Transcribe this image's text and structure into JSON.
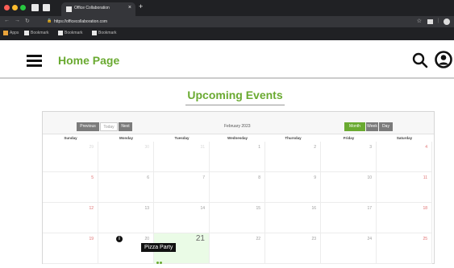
{
  "browser": {
    "tab_title": "Office Collaboration",
    "tab_close": "×",
    "new_tab": "+",
    "url": "https://officecollaboration.com",
    "bookmarks": [
      "Apps",
      "Bookmark",
      "Bookmark",
      "Bookmark"
    ],
    "colors": {
      "close": "#ff5f57",
      "minimize": "#febc2e",
      "maximize": "#28c840"
    }
  },
  "header": {
    "title": "Home Page"
  },
  "section": {
    "title": "Upcoming Events"
  },
  "calendar": {
    "nav": {
      "previous": "Previous",
      "today": "Today",
      "next": "Next"
    },
    "month_label": "February 2023",
    "views": {
      "month": "Month",
      "week": "Week",
      "day": "Day"
    },
    "weekdays": [
      "Sunday",
      "Monday",
      "Tuesday",
      "Wednesday",
      "Thursday",
      "Friday",
      "Saturday"
    ],
    "weeks": [
      [
        "29",
        "30",
        "31",
        "1",
        "2",
        "3",
        "4"
      ],
      [
        "5",
        "6",
        "7",
        "8",
        "9",
        "10",
        "11"
      ],
      [
        "12",
        "13",
        "14",
        "15",
        "16",
        "17",
        "18"
      ],
      [
        "19",
        "20",
        "21",
        "22",
        "23",
        "24",
        "25"
      ]
    ],
    "today": "21",
    "event": {
      "title": "Pizza Party"
    },
    "accent": "#6aaa31"
  }
}
